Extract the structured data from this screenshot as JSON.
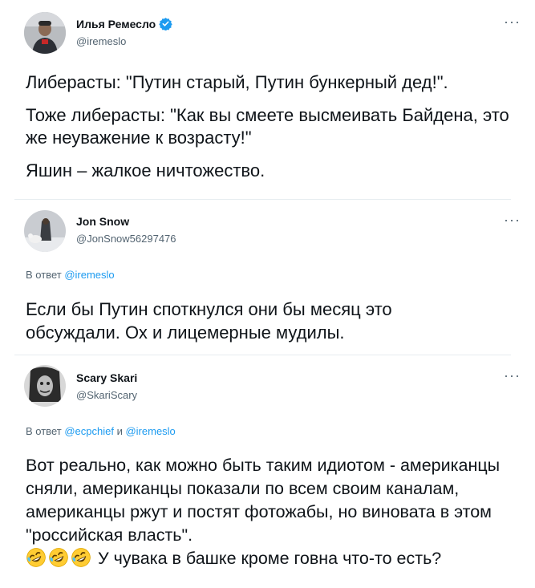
{
  "tweets": [
    {
      "author": "Илья Ремесло",
      "handle": "@iremeslo",
      "verified": true,
      "paragraphs": [
        "Либерасты: \"Путин старый, Путин бункерный дед!\".",
        "Тоже либерасты: \"Как вы смеете высмеивать Байдена, это же неуважение к возрасту!\"",
        "Яшин – жалкое ничтожество."
      ]
    },
    {
      "author": "Jon Snow",
      "handle": "@JonSnow56297476",
      "reply_prefix": "В ответ",
      "reply_to": [
        "@iremeslo"
      ],
      "paragraphs": [
        "Если бы Путин споткнулся они бы месяц это обсуждали. Ох и лицемерные мудилы."
      ]
    },
    {
      "author": "Scary Skari",
      "handle": "@SkariScary",
      "reply_prefix": "В ответ",
      "reply_to": [
        "@ecpchief",
        "@iremeslo"
      ],
      "reply_joiner": "и",
      "paragraphs": [
        "Вот реально, как можно быть таким идиотом - американцы сняли, американцы показали по всем своим каналам, американцы ржут и постят фотожабы, но виновата в этом \"российская власть\"."
      ],
      "tail_emoji": "rolling-on-floor-laughing",
      "tail_text": " У чувака в башке кроме говна что-то есть?"
    }
  ],
  "more_glyph": "···",
  "colors": {
    "link": "#1d9bf0",
    "secondary": "#536471",
    "divider": "#e6ecf0",
    "verified": "#1d9bf0"
  }
}
